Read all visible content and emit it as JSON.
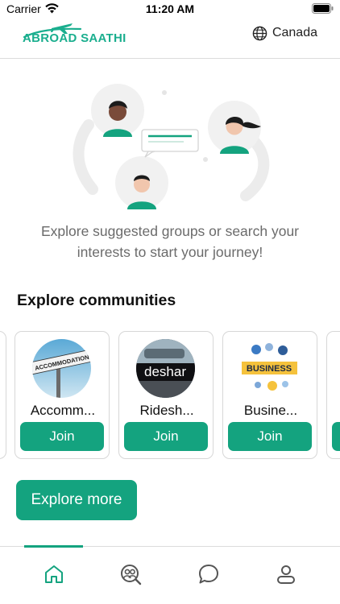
{
  "status_bar": {
    "carrier": "Carrier",
    "time": "11:20 AM",
    "icons": [
      "wifi-icon",
      "battery-icon"
    ]
  },
  "header": {
    "logo_text": "ABROAD SAATHI",
    "region": "Canada",
    "region_icon": "globe-icon",
    "divider_color": "#dcdcdc"
  },
  "hero": {
    "illustration": "people-chat-illustration",
    "message": "Explore suggested groups or search your interests to start your journey!"
  },
  "communities": {
    "title": "Explore communities",
    "cards": [
      {
        "title": "Accomm...",
        "image": "accommodation-sign-image",
        "image_text": "ACCOMMODATION",
        "join_label": "Join"
      },
      {
        "title": "Ridesh...",
        "image": "rideshare-image",
        "image_text": "deshar",
        "join_label": "Join"
      },
      {
        "title": "Busine...",
        "image": "business-image",
        "image_text": "BUSINESS",
        "join_label": "Join"
      }
    ]
  },
  "explore_more_label": "Explore more",
  "tab_bar": {
    "tabs": [
      {
        "name": "home",
        "icon": "home-icon",
        "active": true
      },
      {
        "name": "groups",
        "icon": "groups-search-icon",
        "active": false
      },
      {
        "name": "chat",
        "icon": "chat-bubble-icon",
        "active": false
      },
      {
        "name": "profile",
        "icon": "person-icon",
        "active": false
      }
    ]
  },
  "colors": {
    "accent": "#14a37f",
    "logo": "#1aae8e",
    "muted_text": "#6b6b6b",
    "card_border": "#d7d7d7"
  }
}
